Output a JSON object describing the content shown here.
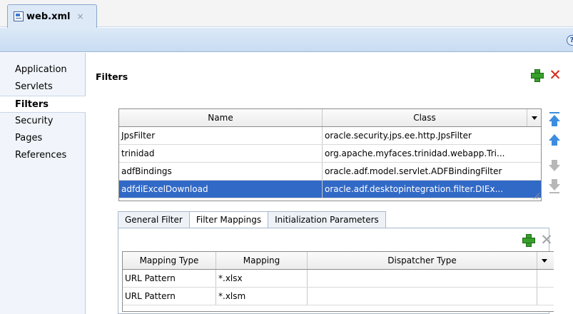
{
  "editor": {
    "tab_title": "web.xml",
    "tab_close": "×",
    "help_glyph": "?"
  },
  "nav": {
    "items": [
      {
        "label": "Application"
      },
      {
        "label": "Servlets"
      },
      {
        "label": "Filters",
        "selected": true
      },
      {
        "label": "Security"
      },
      {
        "label": "Pages"
      },
      {
        "label": "References"
      }
    ]
  },
  "filters": {
    "title": "Filters",
    "columns": [
      "Name",
      "Class"
    ],
    "rows": [
      {
        "name": "JpsFilter",
        "class": "oracle.security.jps.ee.http.JpsFilter"
      },
      {
        "name": "trinidad",
        "class": "org.apache.myfaces.trinidad.webapp.Tri..."
      },
      {
        "name": "adfBindings",
        "class": "oracle.adf.model.servlet.ADFBindingFilter"
      },
      {
        "name": "adfdiExcelDownload",
        "class": "oracle.adf.desktopintegration.filter.DIEx...",
        "selected": true
      }
    ]
  },
  "subtabs": [
    {
      "label": "General Filter"
    },
    {
      "label": "Filter Mappings",
      "selected": true
    },
    {
      "label": "Initialization Parameters"
    }
  ],
  "mappings": {
    "columns": [
      "Mapping Type",
      "Mapping",
      "Dispatcher Type"
    ],
    "rows": [
      {
        "type": "URL Pattern",
        "mapping": "*.xlsx",
        "dispatcher": ""
      },
      {
        "type": "URL Pattern",
        "mapping": "*.xlsm",
        "dispatcher": ""
      }
    ]
  },
  "icons": {
    "add": "add-icon",
    "delete": "delete-icon",
    "move_top": "move-top-icon",
    "move_up": "move-up-icon",
    "move_down": "move-down-icon",
    "move_bottom": "move-bottom-icon"
  },
  "colors": {
    "selection": "#3169c6",
    "header_band": "#c8dcf2",
    "add_green": "#37a02c",
    "delete_red": "#d42a1a"
  }
}
